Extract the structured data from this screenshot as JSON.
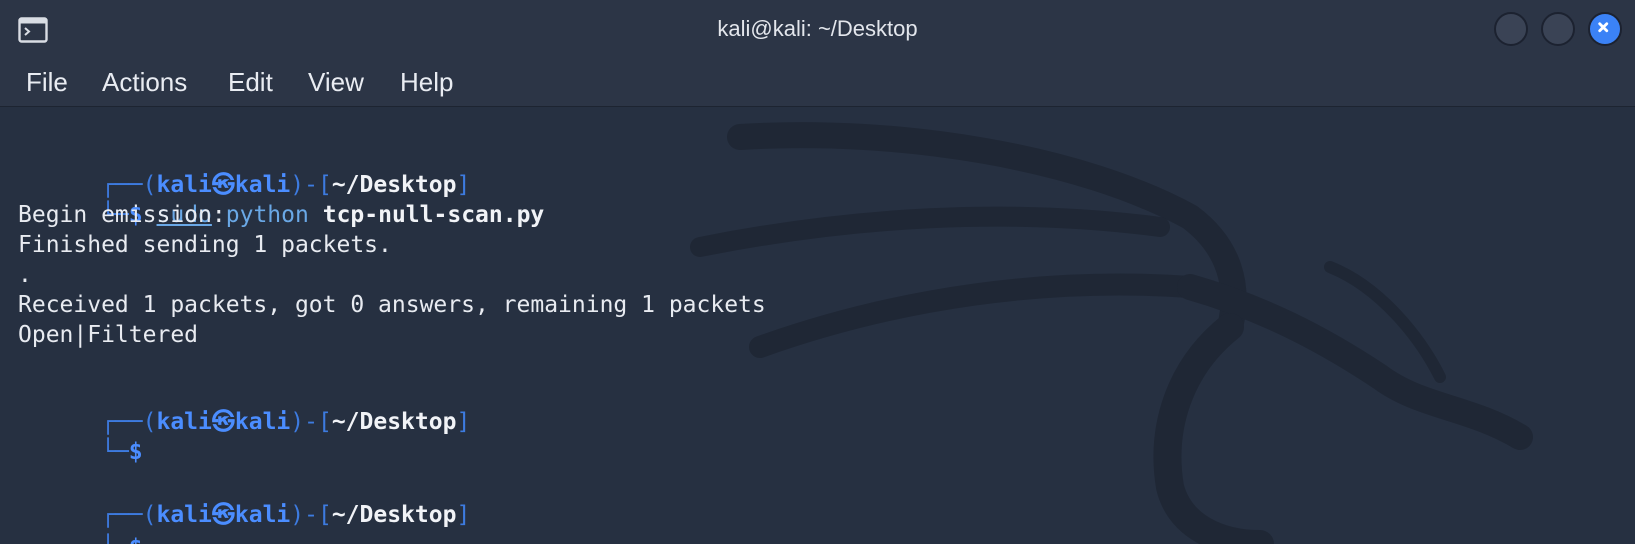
{
  "window": {
    "title": "kali@kali: ~/Desktop",
    "accent_color": "#3b82f6",
    "icons": [
      "terminal-icon",
      "minimize-icon",
      "maximize-icon",
      "close-icon"
    ]
  },
  "menu": {
    "items": [
      "File",
      "Actions",
      "Edit",
      "View",
      "Help"
    ]
  },
  "terminal": {
    "prompt": {
      "open": "┌──(",
      "user": "kali",
      "at_symbol": "㉿",
      "host": "kali",
      "mid": ")-[",
      "path": "~/Desktop",
      "close": "]",
      "line2_prefix": "└─",
      "dollar": "$"
    },
    "command": {
      "sudo": "sudo",
      "python": "python",
      "script": "tcp-null-scan.py"
    },
    "output": [
      "Begin emission:",
      "Finished sending 1 packets.",
      ".",
      "Received 1 packets, got 0 answers, remaining 1 packets",
      "Open|Filtered"
    ]
  }
}
